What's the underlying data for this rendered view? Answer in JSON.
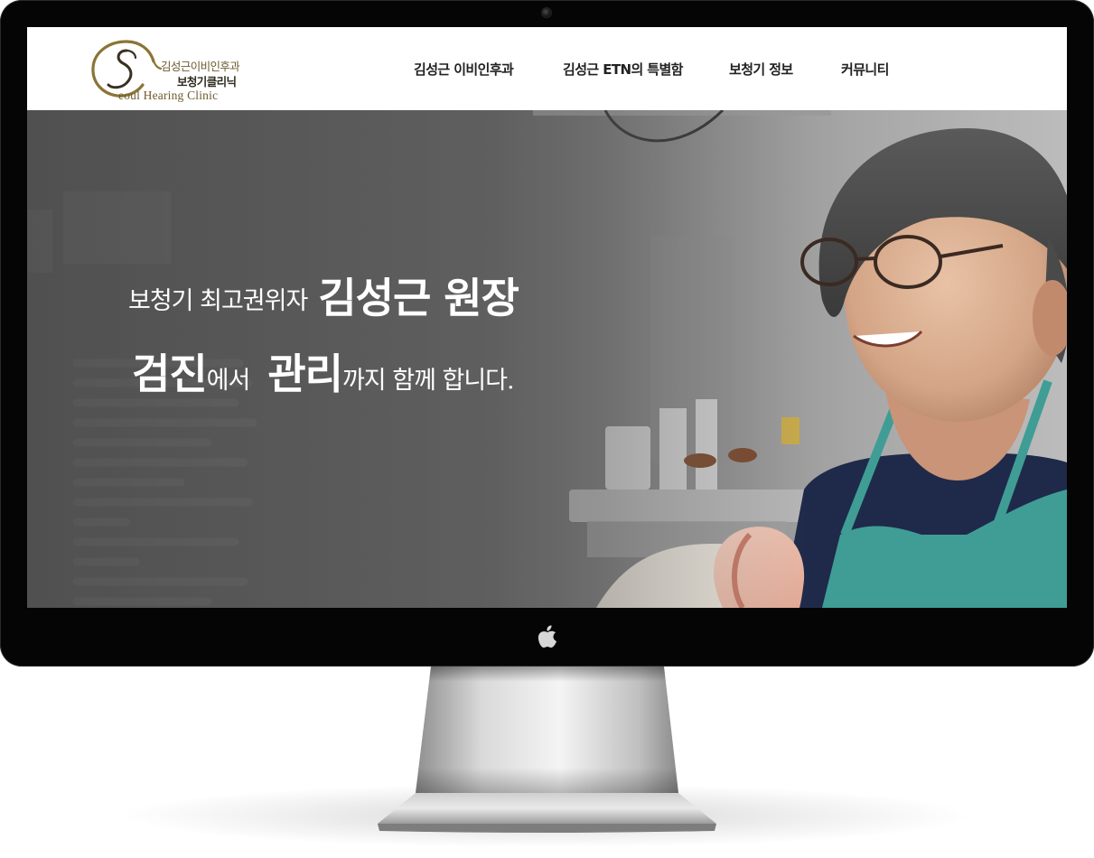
{
  "header": {
    "logo": {
      "line1": "김성근이비인후과",
      "line2": "보청기클리닉",
      "line3": "eoul Hearing Clinic",
      "monogram": "S"
    },
    "nav": [
      {
        "label": "김성근 이비인후과"
      },
      {
        "label": "김성근 ETN의 특별함"
      },
      {
        "label": "보청기 정보"
      },
      {
        "label": "커뮤니티"
      }
    ]
  },
  "hero": {
    "line1_prefix": "보청기 최고권위자",
    "line1_name": "김성근 원장",
    "line2_word1": "검진",
    "line2_connector": "에서",
    "line2_word2": "관리",
    "line2_suffix": "까지 함께 합니다."
  },
  "colors": {
    "brand_gold": "#6d5a2c",
    "nav_text": "#222222",
    "hero_overlay": "#5e5e5e",
    "bezel": "#050505"
  },
  "icons": {
    "monitor_logo": "apple-logo-icon",
    "camera": "camera-icon"
  }
}
